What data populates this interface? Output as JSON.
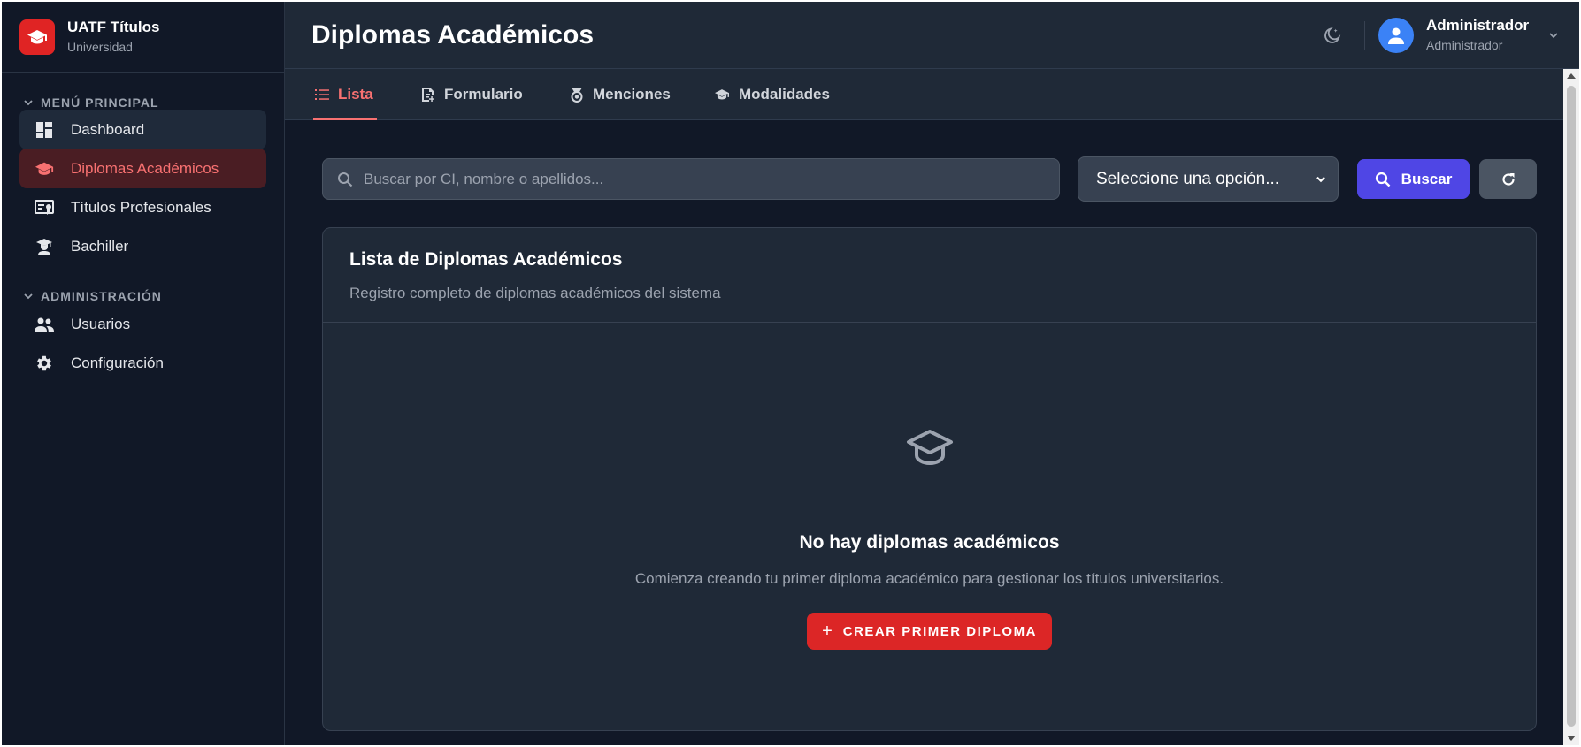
{
  "brand": {
    "title": "UATF Títulos",
    "subtitle": "Universidad"
  },
  "sidebar": {
    "sections": [
      {
        "label": "MENÚ PRINCIPAL"
      },
      {
        "label": "ADMINISTRACIÓN"
      }
    ],
    "items": [
      {
        "label": "Dashboard",
        "icon": "dashboard-icon"
      },
      {
        "label": "Diplomas Académicos",
        "icon": "graduation-cap-icon",
        "active": true
      },
      {
        "label": "Títulos Profesionales",
        "icon": "certificate-icon"
      },
      {
        "label": "Bachiller",
        "icon": "student-icon"
      },
      {
        "label": "Usuarios",
        "icon": "users-icon"
      },
      {
        "label": "Configuración",
        "icon": "gear-icon"
      }
    ]
  },
  "header": {
    "title": "Diplomas Académicos",
    "user": {
      "name": "Administrador",
      "role": "Administrador"
    }
  },
  "tabs": [
    {
      "label": "Lista",
      "icon": "list-icon",
      "active": true
    },
    {
      "label": "Formulario",
      "icon": "form-icon"
    },
    {
      "label": "Menciones",
      "icon": "medal-icon"
    },
    {
      "label": "Modalidades",
      "icon": "graduation-cap-icon"
    }
  ],
  "search": {
    "placeholder": "Buscar por CI, nombre o apellidos...",
    "value": "",
    "select_value": "Seleccione una opción...",
    "search_button": "Buscar"
  },
  "card": {
    "title": "Lista de Diplomas Académicos",
    "subtitle": "Registro completo de diplomas académicos del sistema",
    "empty_title": "No hay diplomas académicos",
    "empty_text": "Comienza creando tu primer diploma académico para gestionar los títulos universitarios.",
    "create_button": "CREAR PRIMER DIPLOMA"
  },
  "colors": {
    "accent": "#dc2626",
    "active_text": "#f87171",
    "primary_button": "#4f46e5",
    "background": "#111827",
    "surface": "#1f2937"
  }
}
